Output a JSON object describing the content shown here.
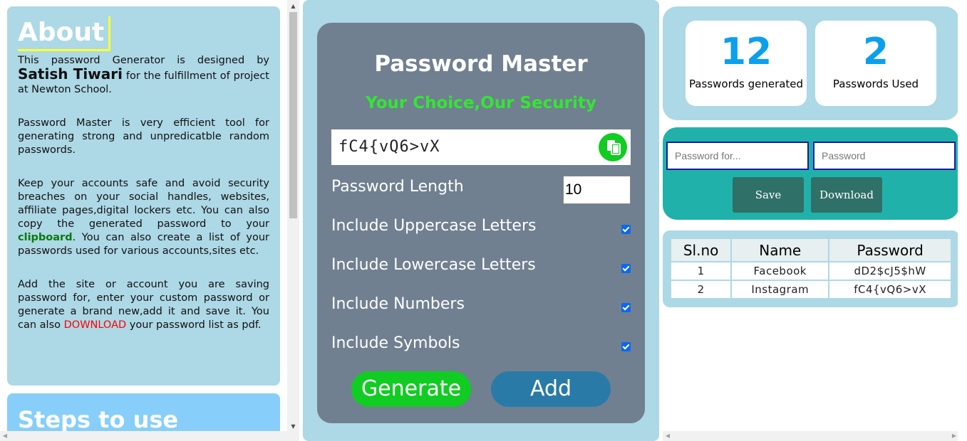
{
  "about": {
    "title": "About",
    "p1_a": "This password Generator is designed by ",
    "p1_author": "Satish Tiwari",
    "p1_b": " for the fulfillment of project at Newton School.",
    "p2": "Password Master is very efficient tool for generating strong and unpredicatble random passwords.",
    "p3_a": "Keep your accounts safe and avoid security breaches on your social handles, websites, affiliate pages,digital lockers etc. You can also copy the generated password to your ",
    "p3_highlight": "clipboard",
    "p3_b": ". You can also create a list of your passwords used for various accounts,sites etc.",
    "p4_a": "Add the site or account you are saving password for, enter your custom password or generate a brand new,add it and save it. You can also ",
    "p4_highlight": "DOWNLOAD",
    "p4_b": " your password list as pdf."
  },
  "steps": {
    "title": "Steps to use"
  },
  "generator": {
    "title": "Password Master",
    "subtitle": "Your Choice,Our Security",
    "password": "fC4{vQ6>vX",
    "copy_icon": "copy-icon",
    "length_label": "Password Length",
    "length_value": "10",
    "options": [
      {
        "label": "Include Uppercase Letters",
        "checked": true
      },
      {
        "label": "Include Lowercase Letters",
        "checked": true
      },
      {
        "label": "Include Numbers",
        "checked": true
      },
      {
        "label": "Include Symbols",
        "checked": true
      }
    ],
    "generate_label": "Generate",
    "add_label": "Add"
  },
  "stats": {
    "generated_count": "12",
    "generated_label": "Passwords generated",
    "used_count": "2",
    "used_label": "Passwords Used"
  },
  "save_form": {
    "site_placeholder": "Password for...",
    "password_placeholder": "Password",
    "save_label": "Save",
    "download_label": "Download"
  },
  "table": {
    "headers": [
      "Sl.no",
      "Name",
      "Password"
    ],
    "rows": [
      [
        "1",
        "Facebook",
        "dD2$cJ5$hW"
      ],
      [
        "2",
        "Instagram",
        "fC4{vQ6>vX"
      ]
    ]
  },
  "colors": {
    "light_blue": "#add8e6",
    "slate": "#708090",
    "green": "#11cc22",
    "teal": "#20b2aa",
    "stat_blue": "#0aa0ee"
  }
}
